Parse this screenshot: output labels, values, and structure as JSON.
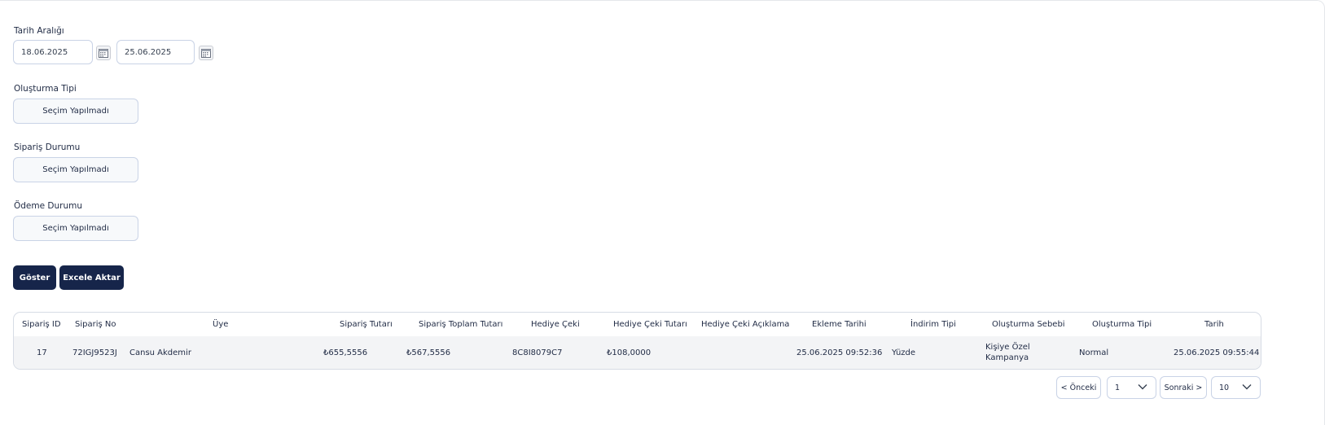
{
  "filters": {
    "date_range_label": "Tarih Aralığı",
    "start_date": "18.06.2025",
    "end_date": "25.06.2025",
    "creation_type_label": "Oluşturma Tipi",
    "creation_type_value": "Seçim Yapılmadı",
    "order_status_label": "Sipariş Durumu",
    "order_status_value": "Seçim Yapılmadı",
    "payment_status_label": "Ödeme Durumu",
    "payment_status_value": "Seçim Yapılmadı"
  },
  "actions": {
    "show_label": "Göster",
    "export_label": "Excele Aktar"
  },
  "table": {
    "headers": [
      "Sipariş ID",
      "Sipariş No",
      "Üye",
      "Sipariş Tutarı",
      "Sipariş Toplam Tutarı",
      "Hediye Çeki",
      "Hediye Çeki Tutarı",
      "Hediye Çeki Açıklama",
      "Ekleme Tarihi",
      "İndirim Tipi",
      "Oluşturma Sebebi",
      "Oluşturma Tipi",
      "Tarih"
    ],
    "rows": [
      {
        "order_id": "17",
        "order_no": "72IGJ9523J",
        "member": "Cansu Akdemir",
        "order_amount": "₺655,5556",
        "order_total": "₺567,5556",
        "gift_card": "8C8I8079C7",
        "gift_card_amount": "₺108,0000",
        "gift_card_desc": "",
        "added_date": "25.06.2025 09:52:36",
        "discount_type": "Yüzde",
        "reason_line1": "Kişiye Özel",
        "reason_line2": "Kampanya",
        "creation_type": "Normal",
        "date": "25.06.2025 09:55:44"
      }
    ]
  },
  "pagination": {
    "prev_label": "< Önceki",
    "page": "1",
    "next_label": "Sonraki >",
    "page_size": "10"
  }
}
